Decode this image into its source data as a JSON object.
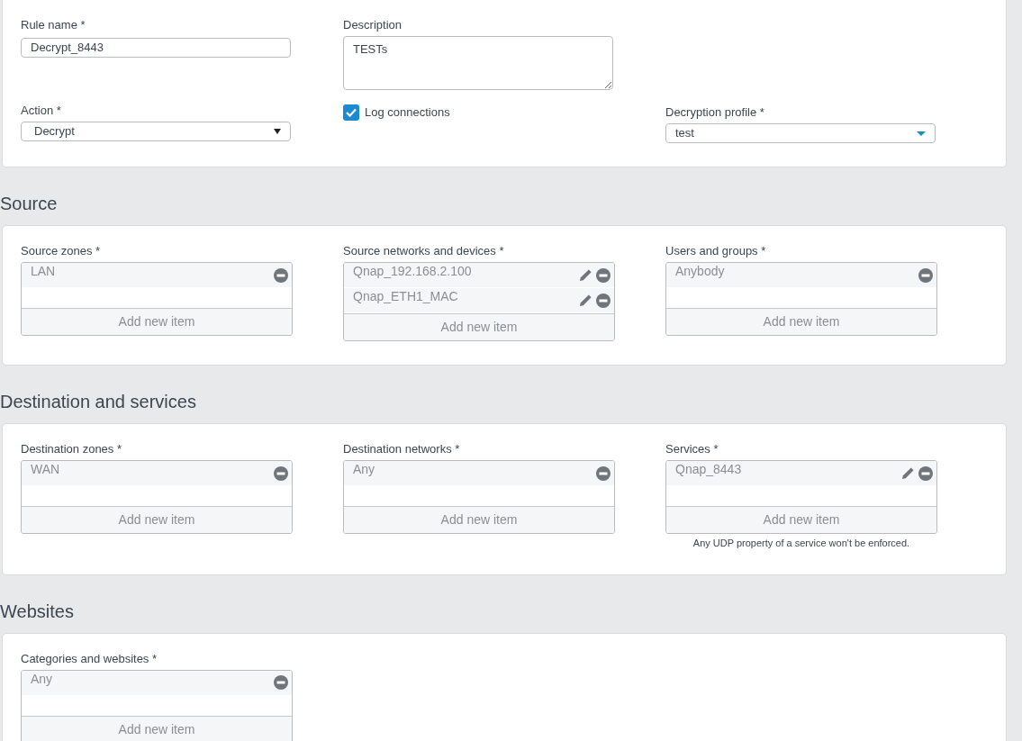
{
  "general": {
    "rule_name": {
      "label": "Rule name *",
      "value": "Decrypt_8443"
    },
    "description": {
      "label": "Description",
      "value": "TESTs"
    },
    "action": {
      "label": "Action *",
      "value": "Decrypt",
      "kind": "native"
    },
    "log_connections": {
      "label": "Log connections",
      "checked": true
    },
    "decryption_profile": {
      "label": "Decryption profile *",
      "value": "test",
      "kind": "styled"
    }
  },
  "sections": [
    {
      "title": "Source",
      "fields": [
        {
          "label": "Source zones *",
          "items": [
            {
              "text": "LAN",
              "editable": false
            }
          ],
          "add_label": "Add new item"
        },
        {
          "label": "Source networks and devices *",
          "items": [
            {
              "text": "Qnap_192.168.2.100",
              "editable": true
            },
            {
              "text": "Qnap_ETH1_MAC",
              "editable": true
            }
          ],
          "add_label": "Add new item"
        },
        {
          "label": "Users and groups *",
          "items": [
            {
              "text": "Anybody",
              "editable": false
            }
          ],
          "add_label": "Add new item"
        }
      ]
    },
    {
      "title": "Destination and services",
      "fields": [
        {
          "label": "Destination zones *",
          "items": [
            {
              "text": "WAN",
              "editable": false
            }
          ],
          "add_label": "Add new item"
        },
        {
          "label": "Destination networks *",
          "items": [
            {
              "text": "Any",
              "editable": false
            }
          ],
          "add_label": "Add new item"
        },
        {
          "label": "Services *",
          "items": [
            {
              "text": "Qnap_8443",
              "editable": true
            }
          ],
          "add_label": "Add new item",
          "note": "Any UDP property of a service won't be enforced."
        }
      ]
    },
    {
      "title": "Websites",
      "fields": [
        {
          "label": "Categories and websites *",
          "items": [
            {
              "text": "Any",
              "editable": false
            }
          ],
          "add_label": "Add new item"
        }
      ]
    }
  ]
}
